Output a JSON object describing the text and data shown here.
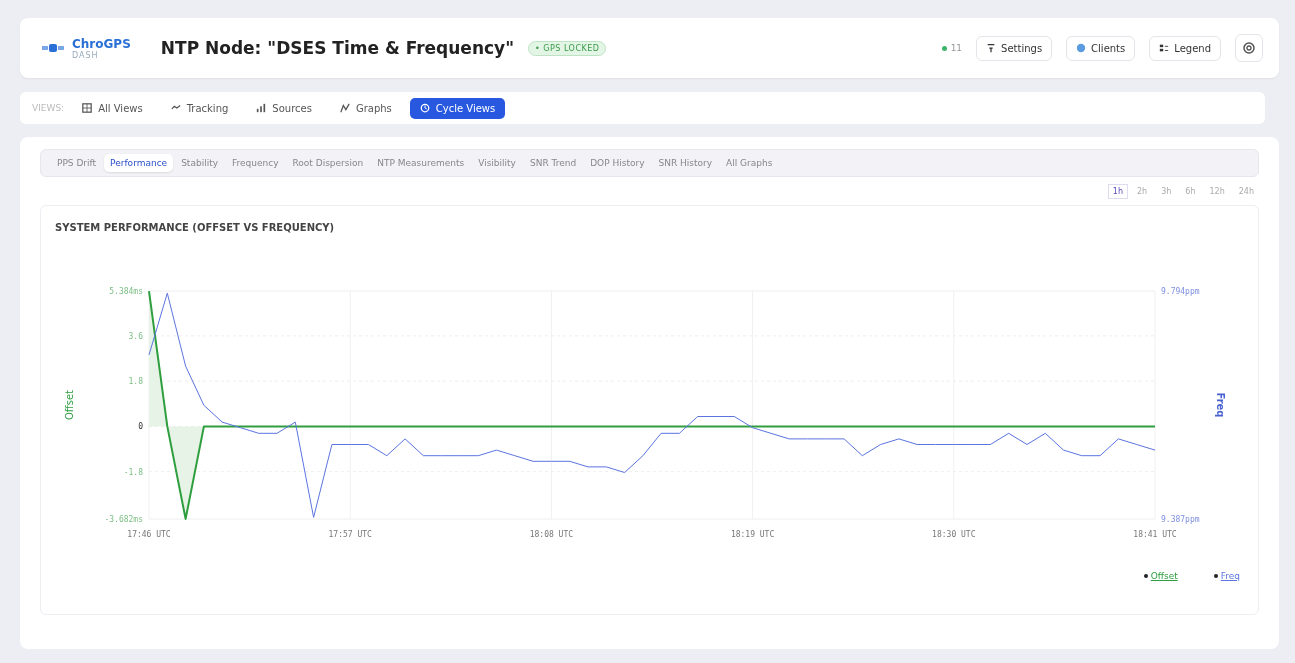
{
  "header": {
    "logo_name": "ChroGPS",
    "logo_sub": "DASH",
    "title": "NTP Node: \"DSES Time & Frequency\"",
    "status_badge": "• GPS LOCKED",
    "client_count": "11",
    "buttons": [
      {
        "label": "Settings",
        "kind": "settings"
      },
      {
        "label": "Clients",
        "kind": "clients"
      },
      {
        "label": "Legend",
        "kind": "legend"
      }
    ]
  },
  "views": {
    "label": "VIEWS:",
    "items": [
      {
        "label": "All Views",
        "kind": "grid",
        "selected": false
      },
      {
        "label": "Tracking",
        "kind": "track",
        "selected": false
      },
      {
        "label": "Sources",
        "kind": "bars",
        "selected": false
      },
      {
        "label": "Graphs",
        "kind": "graph",
        "selected": false
      },
      {
        "label": "Cycle Views",
        "kind": "cycle",
        "selected": true
      }
    ]
  },
  "graph_tabs": [
    {
      "label": "PPS Drift",
      "selected": false
    },
    {
      "label": "Performance",
      "selected": true
    },
    {
      "label": "Stability",
      "selected": false
    },
    {
      "label": "Frequency",
      "selected": false
    },
    {
      "label": "Root Dispersion",
      "selected": false
    },
    {
      "label": "NTP Measurements",
      "selected": false
    },
    {
      "label": "Visibility",
      "selected": false
    },
    {
      "label": "SNR Trend",
      "selected": false
    },
    {
      "label": "DOP History",
      "selected": false
    },
    {
      "label": "SNR History",
      "selected": false
    },
    {
      "label": "All Graphs",
      "selected": false
    }
  ],
  "ranges": [
    {
      "label": "1h",
      "selected": true
    },
    {
      "label": "2h",
      "selected": false
    },
    {
      "label": "3h",
      "selected": false
    },
    {
      "label": "6h",
      "selected": false
    },
    {
      "label": "12h",
      "selected": false
    },
    {
      "label": "24h",
      "selected": false
    }
  ],
  "panel": {
    "title": "SYSTEM PERFORMANCE (OFFSET VS FREQUENCY)",
    "chart_data": {
      "type": "area",
      "grid": true,
      "ylabel": "Offset",
      "y2label": "Freq",
      "categories": [
        "17:46 UTC",
        null,
        null,
        null,
        null,
        null,
        null,
        null,
        null,
        null,
        null,
        "17:57 UTC",
        null,
        null,
        null,
        null,
        null,
        null,
        null,
        null,
        null,
        null,
        "18:08 UTC",
        null,
        null,
        null,
        null,
        null,
        null,
        null,
        null,
        null,
        null,
        "18:19 UTC",
        null,
        null,
        null,
        null,
        null,
        null,
        null,
        null,
        null,
        null,
        "18:30 UTC",
        null,
        null,
        null,
        null,
        null,
        null,
        null,
        null,
        null,
        null,
        "18:41 UTC"
      ],
      "ylim": [
        -3.682,
        5.384
      ],
      "yticks": [
        {
          "value": 5.384,
          "label": "5.384ms"
        },
        {
          "value": 3.6,
          "label": "3.6"
        },
        {
          "value": 1.8,
          "label": "1.8"
        },
        {
          "value": 0,
          "label": "0"
        },
        {
          "value": -1.8,
          "label": "-1.8"
        },
        {
          "value": -3.682,
          "label": "-3.682ms"
        }
      ],
      "y2lim": [
        9.387,
        9.794
      ],
      "y2ticks": [
        {
          "value": 9.794,
          "label": "9.794ppm"
        },
        {
          "value": 9.387,
          "label": "9.387ppm"
        }
      ],
      "series": [
        {
          "name": "Offset",
          "color": "#2e9e3e",
          "type": "area",
          "values": [
            5.38,
            0,
            -3.68,
            0,
            0,
            0,
            0,
            0,
            0,
            0,
            0,
            0,
            0,
            0,
            0,
            0,
            0,
            0,
            0,
            0,
            0,
            0,
            0,
            0,
            0,
            0,
            0,
            0,
            0,
            0,
            0,
            0,
            0,
            0,
            0,
            0,
            0,
            0,
            0,
            0,
            0,
            0,
            0,
            0,
            0,
            0,
            0,
            0,
            0,
            0,
            0,
            0,
            0,
            0,
            0,
            0
          ]
        },
        {
          "name": "Freq",
          "color": "#5b74e0",
          "axis": "y2",
          "type": "line",
          "values": [
            9.68,
            9.79,
            9.66,
            9.59,
            9.56,
            9.55,
            9.54,
            9.54,
            9.56,
            9.39,
            9.52,
            9.52,
            9.52,
            9.5,
            9.53,
            9.5,
            9.5,
            9.5,
            9.5,
            9.51,
            9.5,
            9.49,
            9.49,
            9.49,
            9.48,
            9.48,
            9.47,
            9.5,
            9.54,
            9.54,
            9.57,
            9.57,
            9.57,
            9.55,
            9.54,
            9.53,
            9.53,
            9.53,
            9.53,
            9.5,
            9.52,
            9.53,
            9.52,
            9.52,
            9.52,
            9.52,
            9.52,
            9.54,
            9.52,
            9.54,
            9.51,
            9.5,
            9.5,
            9.53,
            9.52,
            9.51
          ]
        }
      ]
    }
  }
}
